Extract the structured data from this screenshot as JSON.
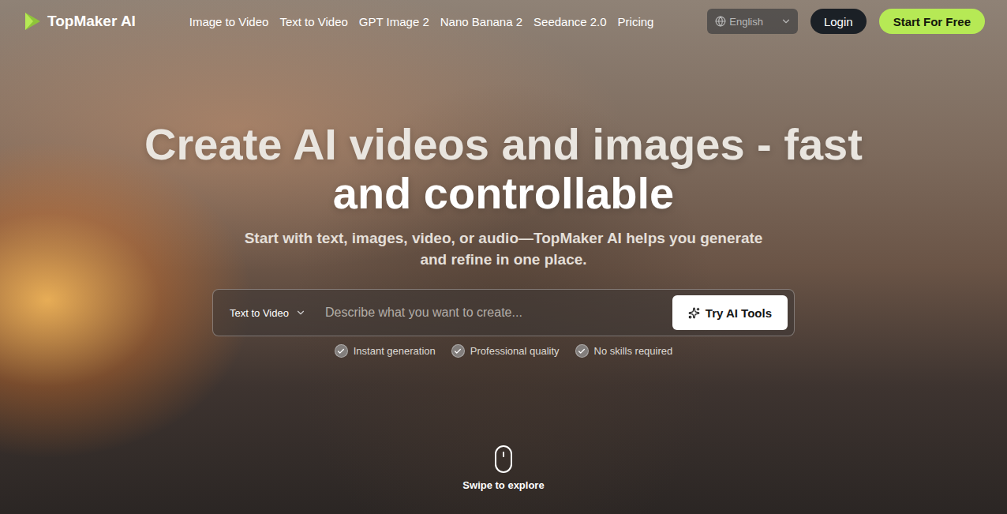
{
  "brand": {
    "name": "TopMaker AI"
  },
  "nav": {
    "items": [
      {
        "label": "Image to Video"
      },
      {
        "label": "Text to Video"
      },
      {
        "label": "GPT Image 2"
      },
      {
        "label": "Nano Banana 2"
      },
      {
        "label": "Seedance 2.0"
      },
      {
        "label": "Pricing"
      }
    ]
  },
  "language": {
    "value": "English"
  },
  "buttons": {
    "login": "Login",
    "start": "Start For Free"
  },
  "hero": {
    "title_lines": [
      "Create AI videos and images - fast",
      "and controllable"
    ],
    "subtitle": "Start with text, images, video, or audio—TopMaker AI helps you generate and refine in one place."
  },
  "prompt": {
    "mode": "Text to Video",
    "placeholder": "Describe what you want to create...",
    "submit": "Try AI Tools"
  },
  "features": [
    {
      "label": "Instant generation",
      "checked": true
    },
    {
      "label": "Professional quality",
      "checked": true
    },
    {
      "label": "No skills required",
      "checked": true
    }
  ],
  "scroll_hint": "Swipe to explore"
}
